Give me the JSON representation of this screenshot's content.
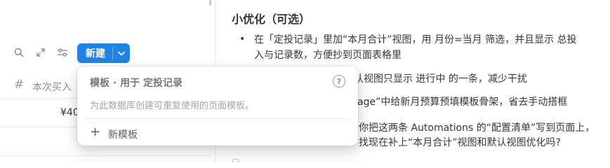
{
  "left": {
    "toolbar": {
      "search_icon": "search-icon",
      "expand_icon": "expand-icon",
      "settings_icon": "sliders-icon",
      "new_label": "新建",
      "new_chevron_icon": "chevron-down-icon",
      "accent": "#2383e2"
    },
    "table": {
      "column_icon": "#",
      "column_label": "本次买入",
      "rows": [
        {
          "value": "¥40"
        },
        {
          "value": ""
        }
      ]
    }
  },
  "popup": {
    "title": "模板 · 用于 定投记录",
    "help_icon": "?",
    "description": "为此数据库创建可重复使用的页面模板。",
    "new_template_icon": "+",
    "new_template_label": "新模板"
  },
  "right": {
    "title": "小优化（可选）",
    "bullets": [
      {
        "line1": "在「定投记录」里加“本月合计”视图，用 月份=当月 筛选，并且显示 总投",
        "line2": "入与记录数，方便抄到页面表格里"
      },
      {
        "line1": "认视图只显示 进行中 的一条，减少干扰"
      },
      {
        "line1": "age”中给新月预算预填模板骨架，省去手动搭框"
      },
      {
        "line1": "你把这两条 Automations 的“配置清单”写到页面上，",
        "line2": "找现在补上“本月合计”视图和默认视图优化吗?"
      }
    ]
  }
}
